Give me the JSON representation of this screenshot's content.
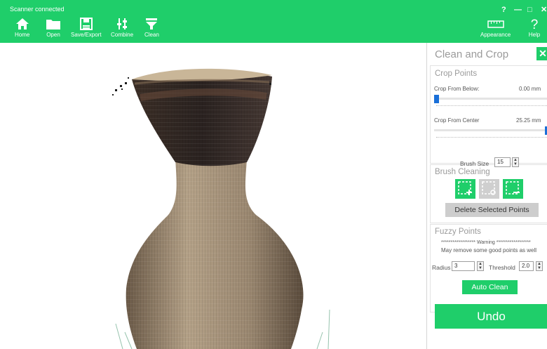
{
  "topbar": {
    "status": "Scanner connected",
    "window_controls": {
      "help": "?",
      "minimize": "—",
      "maximize": "□",
      "close": "✕"
    },
    "tools": [
      {
        "label": "Home",
        "icon": "home-icon"
      },
      {
        "label": "Open",
        "icon": "folder-icon"
      },
      {
        "label": "Save/Export",
        "icon": "floppy-disk-icon"
      },
      {
        "label": "Combine",
        "icon": "combine-icon"
      },
      {
        "label": "Clean",
        "icon": "funnel-icon"
      }
    ],
    "appearance": {
      "label": "Appearance",
      "icon": "ruler-icon"
    },
    "help": {
      "label": "Help",
      "icon": "question-icon"
    }
  },
  "panel": {
    "title": "Clean and Crop",
    "close_icon": "close-x-icon",
    "crop": {
      "title": "Crop Points",
      "below_label": "Crop From Below:",
      "below_value": "0.00 mm",
      "below_level": 0.0,
      "center_label": "Crop From Center",
      "center_value": "25.25 mm",
      "center_level": 1.0
    },
    "brush": {
      "title": "Brush Cleaning",
      "size_label": "Brush Size",
      "size_value": "15",
      "buttons": [
        {
          "icon": "select-add-icon",
          "enabled": true
        },
        {
          "icon": "select-brush-icon",
          "enabled": false
        },
        {
          "icon": "select-remove-icon",
          "enabled": true
        }
      ],
      "delete_label": "Delete Selected Points"
    },
    "fuzzy": {
      "title": "Fuzzy Points",
      "warning": "****************** Warning ******************",
      "warning_detail": "May remove some good points as well",
      "radius_label": "Radius",
      "radius_value": "3",
      "threshold_label": "Threshold",
      "threshold_value": "2.0",
      "auto_label": "Auto Clean"
    },
    "undo_label": "Undo"
  },
  "colors": {
    "accent": "#1fce6a",
    "slider_thumb": "#1a6fd8",
    "disabled": "#cdcdcd"
  }
}
